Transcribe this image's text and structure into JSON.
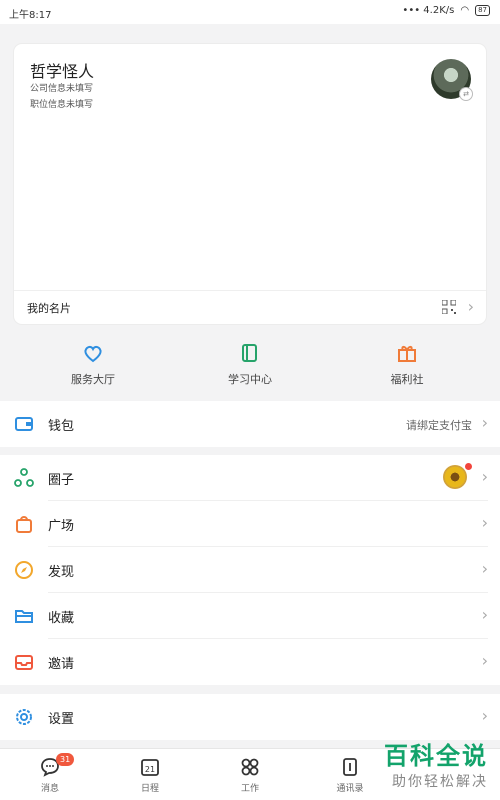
{
  "status": {
    "time": "上午8:17",
    "network": "4.2K/s",
    "battery": "87"
  },
  "profile": {
    "name": "哲学怪人",
    "company": "公司信息未填写",
    "position": "职位信息未填写",
    "card_label": "我的名片"
  },
  "quick": [
    {
      "label": "服务大厅",
      "icon": "heart-hands-icon",
      "color": "#2f8fe0"
    },
    {
      "label": "学习中心",
      "icon": "book-icon",
      "color": "#26a36a"
    },
    {
      "label": "福利社",
      "icon": "gift-icon",
      "color": "#f07b39"
    }
  ],
  "wallet": {
    "label": "钱包",
    "value": "请绑定支付宝",
    "icon": "wallet-icon",
    "color": "#2f8fe0"
  },
  "menu": [
    {
      "label": "圈子",
      "icon": "circle-network-icon",
      "color": "#26a36a"
    },
    {
      "label": "广场",
      "icon": "shopping-bag-icon",
      "color": "#f07b39"
    },
    {
      "label": "发现",
      "icon": "compass-icon",
      "color": "#f2a72c"
    },
    {
      "label": "收藏",
      "icon": "folder-icon",
      "color": "#2f8fe0"
    },
    {
      "label": "邀请",
      "icon": "envelope-icon",
      "color": "#f0583d"
    }
  ],
  "settings": {
    "label": "设置",
    "icon": "gear-icon",
    "color": "#2f8fe0"
  },
  "tabs": [
    {
      "label": "消息",
      "badge": "31",
      "icon": "chat-icon"
    },
    {
      "label": "日程",
      "icon": "calendar-icon",
      "day": "21"
    },
    {
      "label": "工作",
      "icon": "grid-icon"
    },
    {
      "label": "通讯录",
      "icon": "contacts-icon"
    }
  ],
  "watermark": {
    "line1": "百科全说",
    "line2": "助你轻松解决"
  }
}
